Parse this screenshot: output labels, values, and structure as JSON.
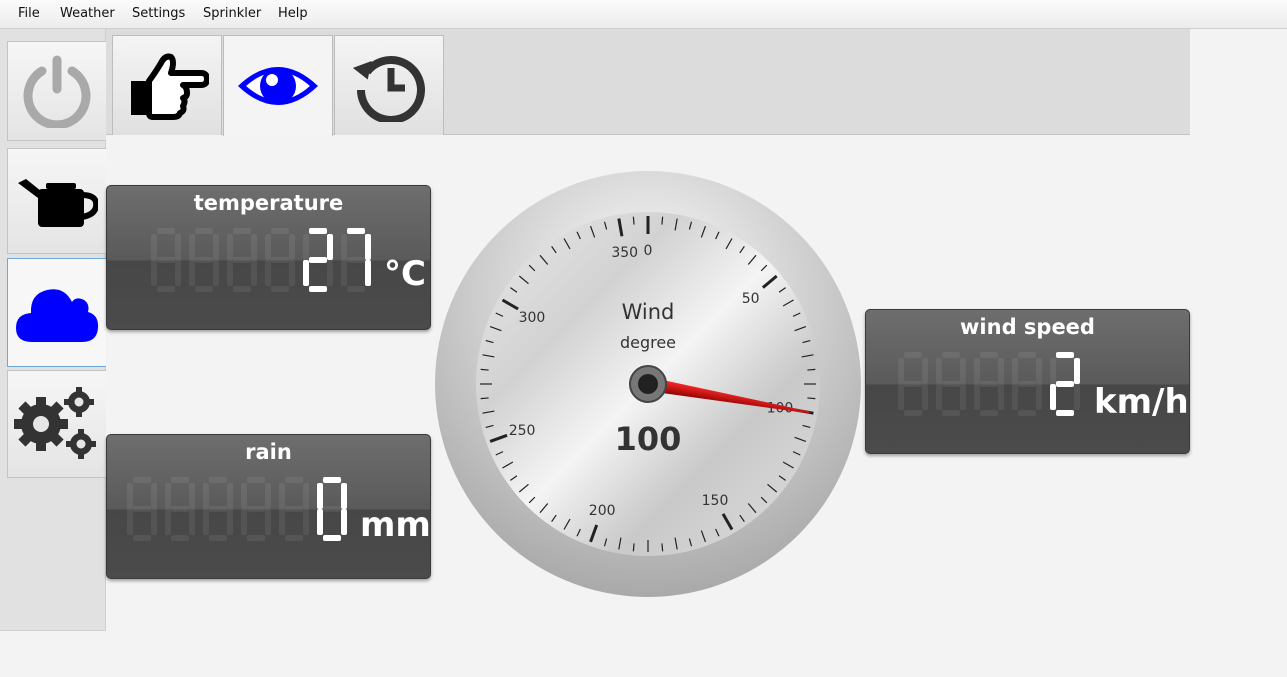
{
  "menu": {
    "file": "File",
    "weather": "Weather",
    "settings": "Settings",
    "sprinkler": "Sprinkler",
    "help": "Help"
  },
  "sidebar": {
    "items": [
      {
        "icon": "power-icon",
        "active": false
      },
      {
        "icon": "watering-can-icon",
        "active": false
      },
      {
        "icon": "cloud-icon",
        "active": true
      },
      {
        "icon": "gears-icon",
        "active": false
      }
    ]
  },
  "tabs": [
    {
      "icon": "pointing-hand-icon",
      "active": false
    },
    {
      "icon": "eye-icon",
      "active": true
    },
    {
      "icon": "history-icon",
      "active": false
    }
  ],
  "temperature": {
    "title": "temperature",
    "value": "27",
    "unit": "°C"
  },
  "rain": {
    "title": "rain",
    "value": "0",
    "unit": "mm"
  },
  "wind_speed": {
    "title": "wind speed",
    "value": "2",
    "unit": "km/h"
  },
  "wind_gauge": {
    "title": "Wind",
    "unit": "degree",
    "value": "100",
    "needle_degrees": 100,
    "tick_labels": [
      "0",
      "50",
      "100",
      "150",
      "200",
      "250",
      "300",
      "350"
    ]
  },
  "colors": {
    "accent": "#0000ff",
    "needle": "#cc0000",
    "lcd_text": "#ffffff"
  }
}
